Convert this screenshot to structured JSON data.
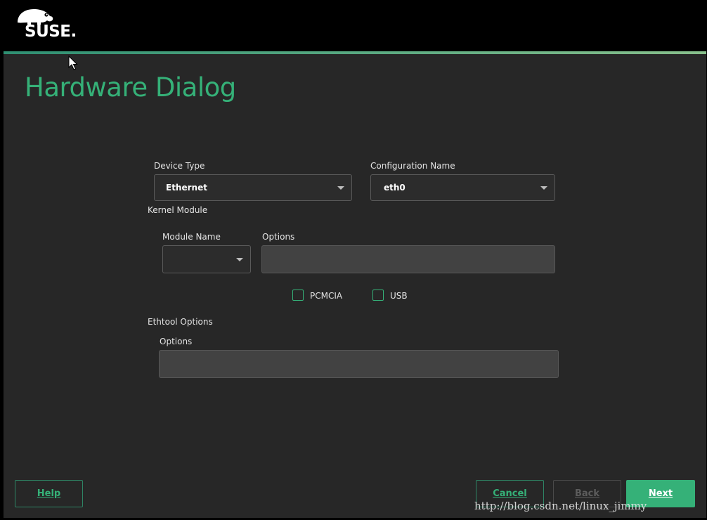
{
  "header": {
    "brand": "SUSE."
  },
  "page": {
    "title": "Hardware Dialog"
  },
  "device_type": {
    "label": "Device Type",
    "value": "Ethernet"
  },
  "configuration_name": {
    "label": "Configuration Name",
    "value": "eth0"
  },
  "kernel_module": {
    "heading": "Kernel Module",
    "module_name_label": "Module Name",
    "module_name_value": "",
    "options_label": "Options",
    "options_value": ""
  },
  "checkboxes": {
    "pcmcia_label": "PCMCIA",
    "pcmcia_checked": false,
    "usb_label": "USB",
    "usb_checked": false
  },
  "ethtool": {
    "heading": "Ethtool Options",
    "options_label": "Options",
    "options_value": ""
  },
  "buttons": {
    "help": "Help",
    "cancel": "Cancel",
    "back": "Back",
    "next": "Next"
  },
  "watermark": "http://blog.csdn.net/linux_jimmy",
  "colors": {
    "accent": "#35b178",
    "background": "#272727",
    "header": "#000000"
  },
  "icons": {
    "logo": "suse-chameleon-logo",
    "cursor": "mouse-pointer-icon",
    "dropdown": "chevron-down-icon"
  }
}
